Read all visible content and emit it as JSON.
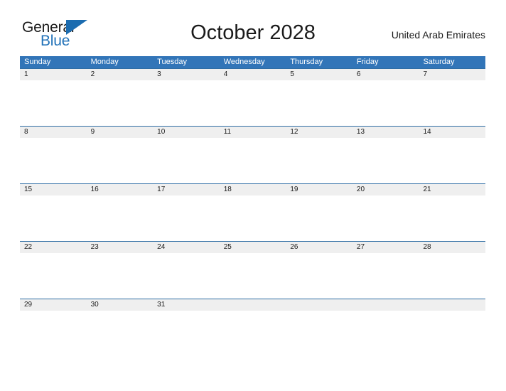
{
  "brand": {
    "name_part1": "General",
    "name_part2": "Blue",
    "flag_icon": "blue-triangle-flag-icon",
    "accent_color": "#2272b8"
  },
  "header": {
    "title": "October 2028",
    "locale": "United Arab Emirates"
  },
  "colors": {
    "header_blue": "#3275b8",
    "row_divider_blue": "#2e6da4",
    "date_band_gray": "#efefef",
    "text_dark": "#1b1b1b",
    "background": "#ffffff"
  },
  "calendar": {
    "month": "October",
    "year": "2028",
    "weekday_headers": [
      "Sunday",
      "Monday",
      "Tuesday",
      "Wednesday",
      "Thursday",
      "Friday",
      "Saturday"
    ],
    "weeks": [
      {
        "dates": [
          "1",
          "2",
          "3",
          "4",
          "5",
          "6",
          "7"
        ]
      },
      {
        "dates": [
          "8",
          "9",
          "10",
          "11",
          "12",
          "13",
          "14"
        ]
      },
      {
        "dates": [
          "15",
          "16",
          "17",
          "18",
          "19",
          "20",
          "21"
        ]
      },
      {
        "dates": [
          "22",
          "23",
          "24",
          "25",
          "26",
          "27",
          "28"
        ]
      },
      {
        "dates": [
          "29",
          "30",
          "31",
          "",
          "",
          "",
          ""
        ]
      }
    ]
  }
}
